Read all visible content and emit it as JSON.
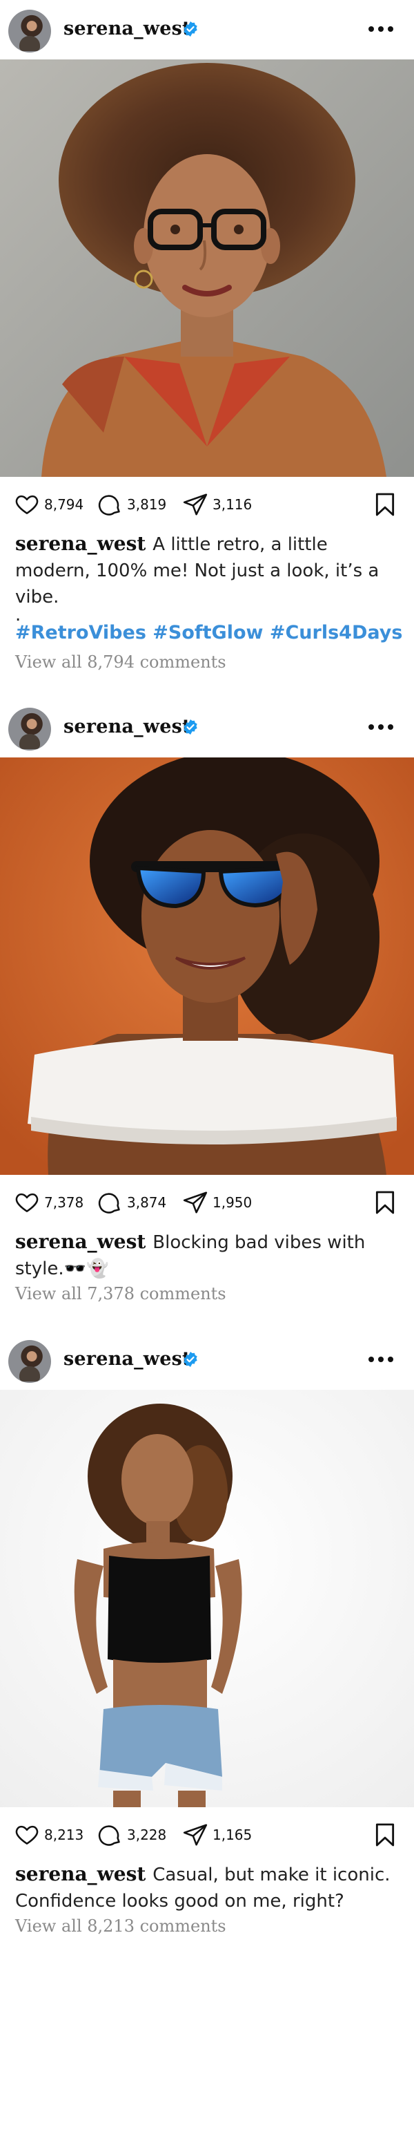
{
  "colors": {
    "verified": "#1d9bf0",
    "hashtag": "#3b8fd9",
    "muted": "#8a8a8a"
  },
  "icons": {
    "like": "heart-icon",
    "comment": "comment-bubble-icon",
    "share": "paper-plane-icon",
    "save": "bookmark-icon",
    "menu": "more-horizontal-icon",
    "badge": "verified-badge-icon"
  },
  "posts": [
    {
      "username": "serena_west",
      "likes": "8,794",
      "comments": "3,819",
      "shares": "3,116",
      "caption": "A little retro, a little modern, 100% me! Not just a look, it’s a vibe.",
      "dot": ".",
      "hashtags": "#RetroVibes #SoftGlow #Curls4Days",
      "view_comments": "View all 8,794 comments",
      "photo_desc": "portrait-retro-glasses"
    },
    {
      "username": "serena_west",
      "likes": "7,378",
      "comments": "3,874",
      "shares": "1,950",
      "caption": "Blocking bad vibes with style.🕶️👻",
      "view_comments": "View all 7,378 comments",
      "photo_desc": "portrait-blue-sunglasses"
    },
    {
      "username": "serena_west",
      "likes": "8,213",
      "comments": "3,228",
      "shares": "1,165",
      "caption": "Casual, but make it iconic. Confidence looks good on me, right?",
      "view_comments": "View all 8,213 comments",
      "photo_desc": "portrait-crop-top-denim"
    }
  ]
}
